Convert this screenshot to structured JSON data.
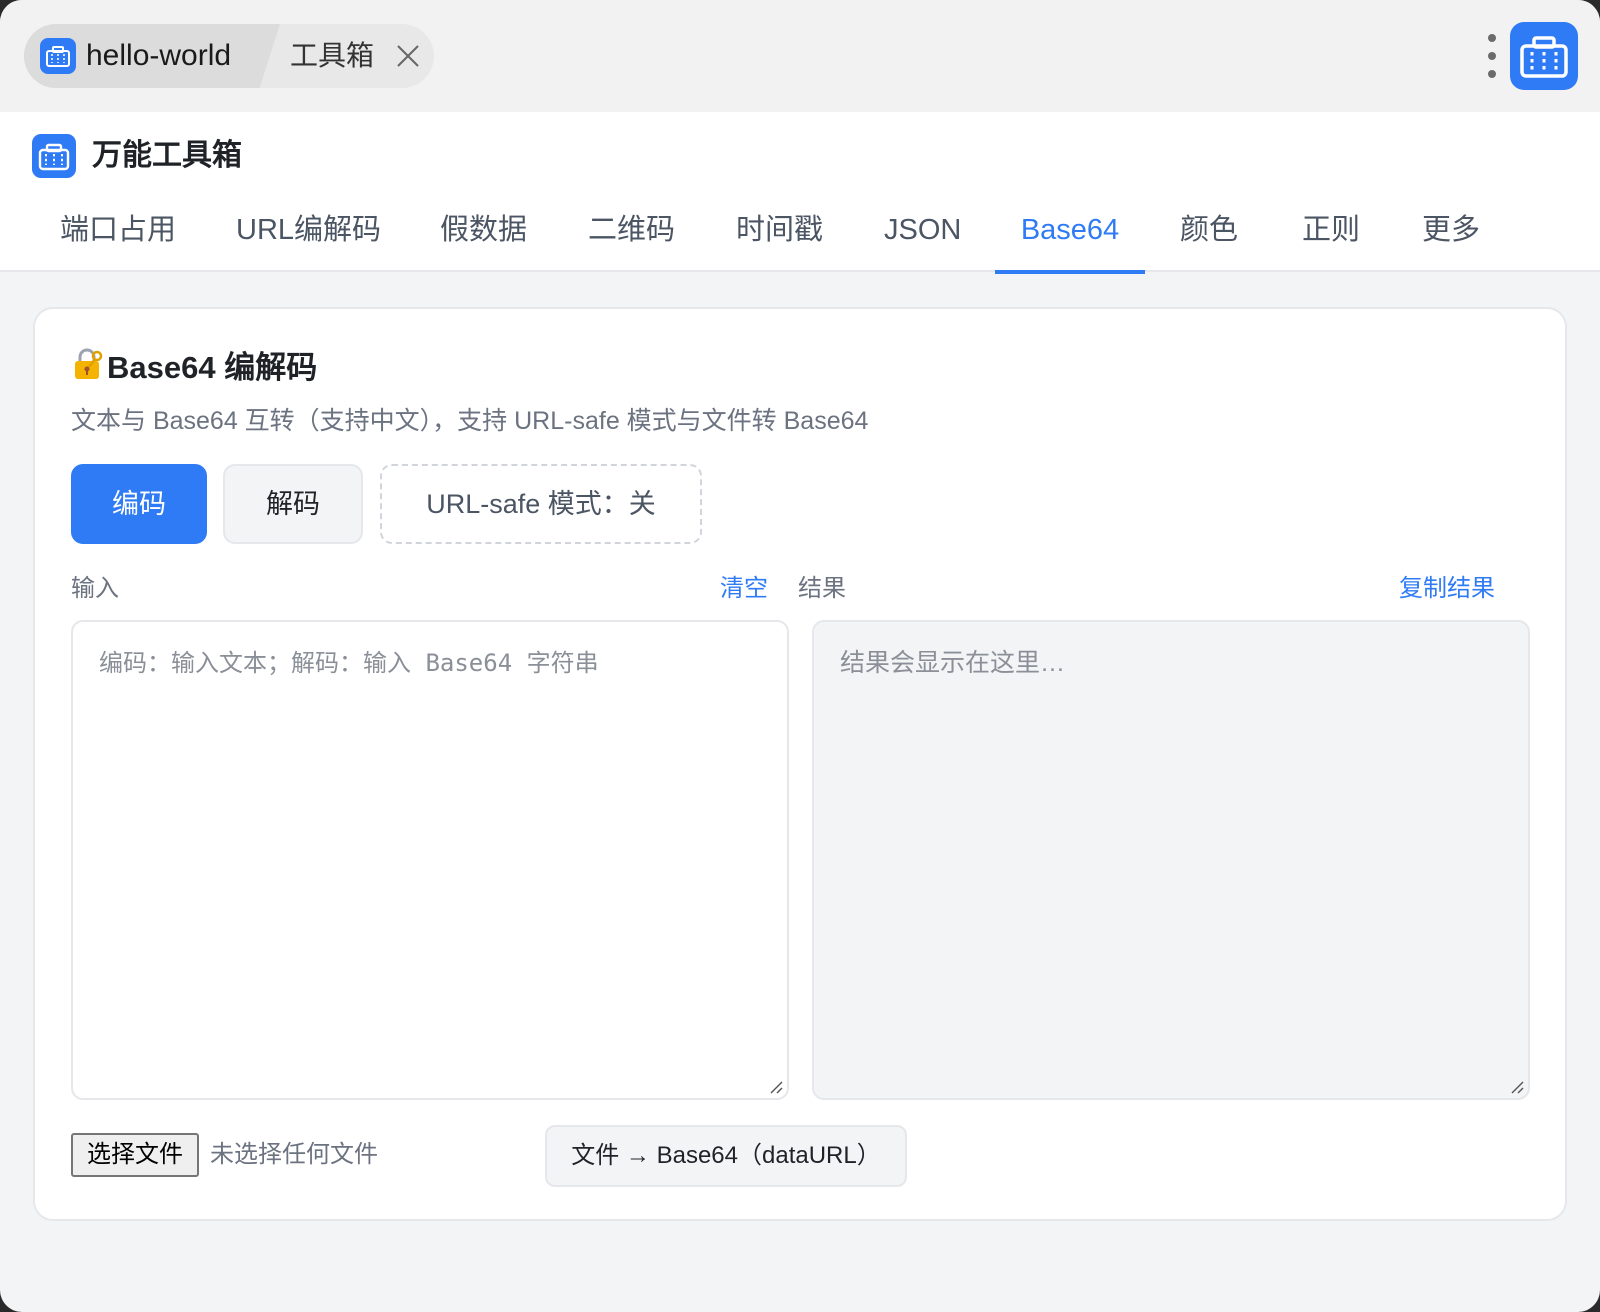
{
  "tabs": {
    "active_label": "hello-world",
    "second_label": "工具箱"
  },
  "app": {
    "title": "万能工具箱",
    "accent_color": "#2f7bf5"
  },
  "nav": {
    "items": [
      {
        "label": "端口占用"
      },
      {
        "label": "URL编解码"
      },
      {
        "label": "假数据"
      },
      {
        "label": "二维码"
      },
      {
        "label": "时间戳"
      },
      {
        "label": "JSON"
      },
      {
        "label": "Base64",
        "active": true
      },
      {
        "label": "颜色"
      },
      {
        "label": "正则"
      },
      {
        "label": "更多"
      }
    ]
  },
  "card": {
    "title": "Base64 编解码",
    "title_icon": "lock-with-key-icon",
    "description": "文本与 Base64 互转（支持中文），支持 URL-safe 模式与文件转 Base64",
    "buttons": {
      "encode": "编码",
      "decode": "解码",
      "url_safe": "URL-safe 模式：关"
    },
    "input": {
      "label": "输入",
      "clear_link": "清空",
      "placeholder": "编码：输入文本；解码：输入 Base64 字符串"
    },
    "result": {
      "label": "结果",
      "copy_link": "复制结果",
      "placeholder": "结果会显示在这里…"
    },
    "file": {
      "choose_button": "选择文件",
      "status": "未选择任何文件",
      "convert_button": "文件 → Base64（dataURL）"
    }
  }
}
